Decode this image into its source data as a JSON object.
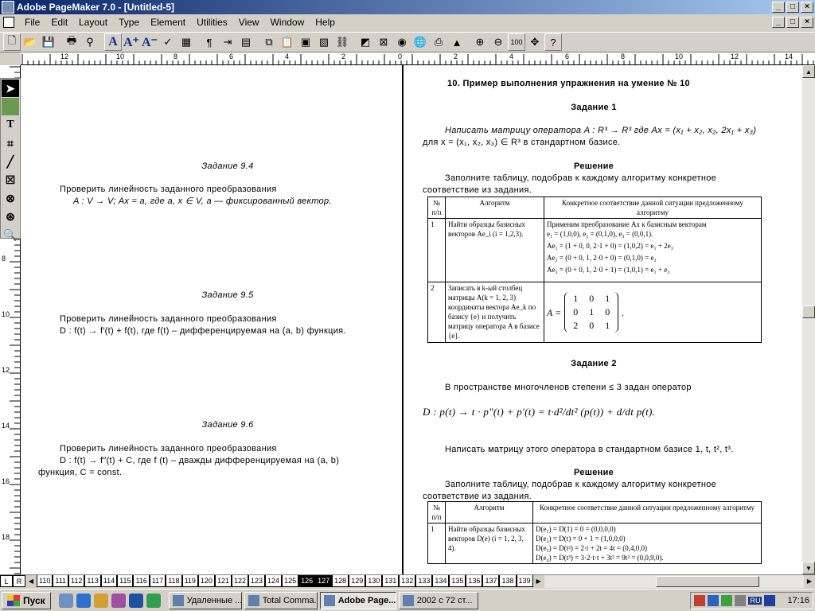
{
  "window": {
    "title": "Adobe PageMaker 7.0 - [Untitled-5]",
    "controls": [
      "_",
      "□",
      "×"
    ]
  },
  "menu": [
    "File",
    "Edit",
    "Layout",
    "Type",
    "Element",
    "Utilities",
    "View",
    "Window",
    "Help"
  ],
  "toolbar_icons": [
    "new-icon",
    "open-icon",
    "save-icon",
    "print-icon",
    "find-icon",
    "font-icon",
    "font-size-icon",
    "font-size-down-icon",
    "spellcheck-icon",
    "table-icon",
    "paragraph-icon",
    "tab-icon",
    "text-frame-icon",
    "zoom-100-icon",
    "help-icon"
  ],
  "toolbar": {
    "zoom_label": "100"
  },
  "ruler": {
    "h_labels": [
      "12",
      "10",
      "8",
      "6",
      "4",
      "2",
      "0",
      "2",
      "4",
      "6",
      "8",
      "10",
      "12",
      "14"
    ],
    "v_labels": [
      "8",
      "10",
      "12",
      "14",
      "16",
      "18"
    ]
  },
  "left_page": {
    "t94_title": "Задание 9.4",
    "t94_line1": "Проверить линейность заданного преобразования",
    "t94_line2": "A : V → V; Ax = a, где a, x ∈ V, a — фиксированный вектор.",
    "t95_title": "Задание 9.5",
    "t95_line1": "Проверить линейность заданного преобразования",
    "t95_line2": "D : f(t) → f′(t) + f(t), где f(t) – дифференцируемая на (a, b) функция.",
    "t96_title": "Задание 9.6",
    "t96_line1": "Проверить линейность заданного преобразования",
    "t96_line2": "D : f(t) → f″(t) + C, где f (t) – дважды дифференцируемая на (a, b)",
    "t96_line3": "функция, C = const."
  },
  "right_page": {
    "heading": "10. Пример выполнения упражнения на умение № 10",
    "task1_title": "Задание 1",
    "task1_line1": "Написать матрицу оператора A : R³ → R³ где Ax = (x₁ + x₂, x₂, 2x₁ + x₃)",
    "task1_line2": "для x = (x₁, x₂, x₃) ∈ R³ в стандартном базисе.",
    "solution_title": "Решение",
    "solution_line1": "Заполните таблицу, подобрав к каждому алгоритму конкретное",
    "solution_line2": "соответствие из задания.",
    "table1": {
      "headers": [
        "№ п/п",
        "Алгоритм",
        "Конкретное соответствие данной ситуации предложенному алгоритму"
      ],
      "rows": [
        {
          "num": "1",
          "algo": "Найти образцы базисных векторов Ae_i (i = 1,2,3).",
          "line1": "Применим преобразование Ax к базисным векторам",
          "line2": "e₁ = (1,0,0), e₂ = (0,1,0), e₃ = (0,0,1).",
          "line3": "Ae₁ = (1 + 0, 0, 2·1 + 0) = (1,0,2) = e₁ + 2e₃",
          "line4": "Ae₂ = (0 + 0, 1, 2·0 + 0) = (0,1,0) = e₂",
          "line5": "Ae₃ = (0 + 0, 1, 2·0 + 1) = (1,0,1) = e₁ + e₃"
        },
        {
          "num": "2",
          "algo": "Записать в k-ый столбец матрицы A(k = 1, 2, 3) координаты вектора Ae_k по базису {e} и получить матрицу оператора A в базисе {e}.",
          "matrix_prefix": "A =",
          "matrix": [
            [
              "1",
              "0",
              "1"
            ],
            [
              "0",
              "1",
              "0"
            ],
            [
              "2",
              "0",
              "1"
            ]
          ],
          "matrix_suffix": "."
        }
      ]
    },
    "task2_title": "Задание 2",
    "task2_line1": "В пространстве многочленов степени ≤ 3 задан оператор",
    "task2_formula": "D : p(t) → t · p″(t) + p′(t) = t·d²/dt² (p(t)) + d/dt p(t).",
    "task2_line2": "Написать матрицу этого оператора в стандартном базисе 1, t, t², t³.",
    "solution2_title": "Решение",
    "solution2_line1": "Заполните таблицу, подобрав к каждому алгоритму конкретное",
    "solution2_line2": "соответствие из задания.",
    "table2": {
      "headers": [
        "№ п/п",
        "Алгоритм",
        "Конкретное соответствие данной ситуации предложенному алгоритму"
      ],
      "row": {
        "num": "1",
        "algo": "Найти образцы базисных векторов D(e) (i = 1, 2, 3, 4).",
        "line1": "D(e₁) = D(1) = 0 = (0,0,0,0)",
        "line2": "D(e₂) = D(t) = 0 + 1 = (1,0,0,0)",
        "line3": "D(e₃) = D(t²) = 2·t + 2t = 4t = (0,4,0,0)",
        "line4": "D(e₄) = D(t³) = 3·2·t·t + 3t² = 9t² = (0,0,9,0)."
      }
    }
  },
  "pagebar": {
    "left_label": "L",
    "right_label": "R",
    "pages": [
      "110",
      "111",
      "112",
      "113",
      "114",
      "115",
      "116",
      "117",
      "118",
      "119",
      "120",
      "121",
      "122",
      "123",
      "124",
      "125",
      "126",
      "127",
      "128",
      "129",
      "130",
      "131",
      "132",
      "133",
      "134",
      "135",
      "136",
      "137",
      "138",
      "139"
    ],
    "active_pages": [
      "126",
      "127"
    ]
  },
  "taskbar": {
    "start_label": "Пуск",
    "tasks": [
      "Удаленные ...",
      "Total Comma...",
      "Adobe Page...",
      "2002 с 72 ст..."
    ],
    "active_task": "Adobe Page...",
    "lang": "RU",
    "clock": "17:16"
  }
}
